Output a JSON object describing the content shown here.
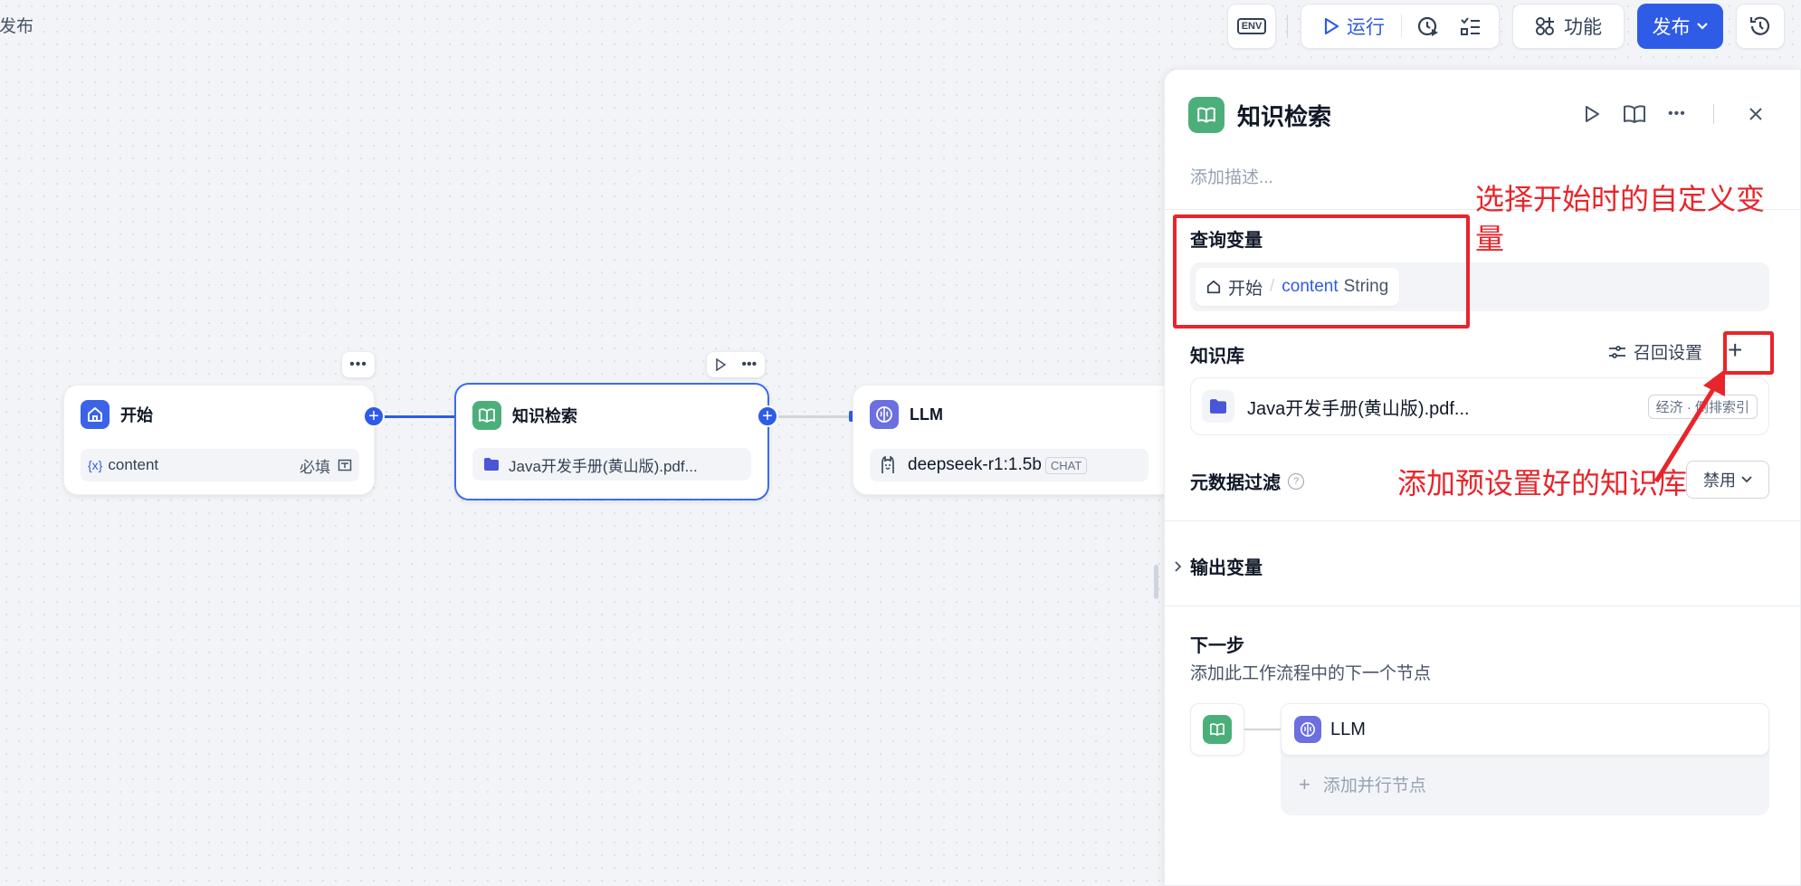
{
  "canvas": {
    "status_fragment": "未发布"
  },
  "toolbar": {
    "env_label": "ENV",
    "run_label": "运行",
    "features_label": "功能",
    "publish_label": "发布"
  },
  "nodes": {
    "start": {
      "title": "开始",
      "var_prefix": "{x}",
      "var_name": "content",
      "required_label": "必填"
    },
    "knowledge": {
      "title": "知识检索",
      "file": "Java开发手册(黄山版).pdf..."
    },
    "llm": {
      "title": "LLM",
      "model": "deepseek-r1:1.5b",
      "badge": "CHAT"
    }
  },
  "panel": {
    "title": "知识检索",
    "desc_placeholder": "添加描述...",
    "query_var": {
      "label": "查询变量",
      "source": "开始",
      "separator": "/",
      "var": "content",
      "type": "String"
    },
    "kb": {
      "label": "知识库",
      "recall_label": "召回设置",
      "file": "Java开发手册(黄山版).pdf...",
      "tag": "经济 · 倒排索引"
    },
    "metadata_filter": {
      "label": "元数据过滤",
      "value": "禁用"
    },
    "output_vars": {
      "label": "输出变量"
    },
    "next_step": {
      "title": "下一步",
      "desc": "添加此工作流程中的下一个节点",
      "next_node": "LLM",
      "add_parallel": "添加并行节点"
    }
  },
  "annotations": {
    "select_var": "选择开始时的自定义变量",
    "add_kb": "添加预设置好的知识库"
  },
  "colors": {
    "primary": "#2e5ce6",
    "start_icon": "#3a63e8",
    "knowledge_icon": "#4caf7a",
    "llm_icon": "#6b6fe0",
    "annotation": "#e8252b"
  }
}
